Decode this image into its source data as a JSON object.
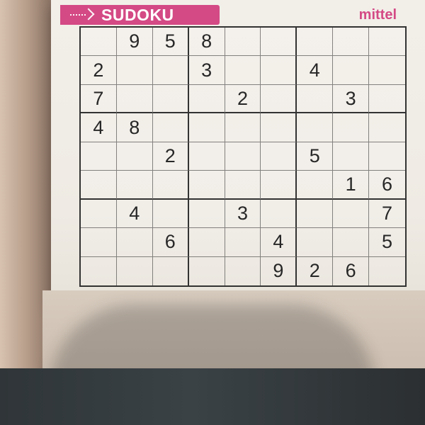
{
  "header": {
    "title": "SUDOKU",
    "difficulty": "mittel"
  },
  "icons": {
    "arrow": "arrow-right-icon"
  },
  "colors": {
    "banner": "#d44a85",
    "grid_line": "#333333",
    "paper": "#efebe4"
  },
  "puzzle": {
    "rows": [
      [
        "",
        "9",
        "5",
        "8",
        "",
        "",
        "",
        "",
        ""
      ],
      [
        "2",
        "",
        "",
        "3",
        "",
        "",
        "4",
        "",
        ""
      ],
      [
        "7",
        "",
        "",
        "",
        "2",
        "",
        "",
        "3",
        ""
      ],
      [
        "4",
        "8",
        "",
        "",
        "",
        "",
        "",
        "",
        ""
      ],
      [
        "",
        "",
        "2",
        "",
        "",
        "",
        "5",
        "",
        ""
      ],
      [
        "",
        "",
        "",
        "",
        "",
        "",
        "",
        "1",
        "6"
      ],
      [
        "",
        "4",
        "",
        "",
        "3",
        "",
        "",
        "",
        "7"
      ],
      [
        "",
        "",
        "6",
        "",
        "",
        "4",
        "",
        "",
        "5"
      ],
      [
        "",
        "",
        "",
        "",
        "",
        "9",
        "2",
        "6",
        ""
      ]
    ]
  }
}
